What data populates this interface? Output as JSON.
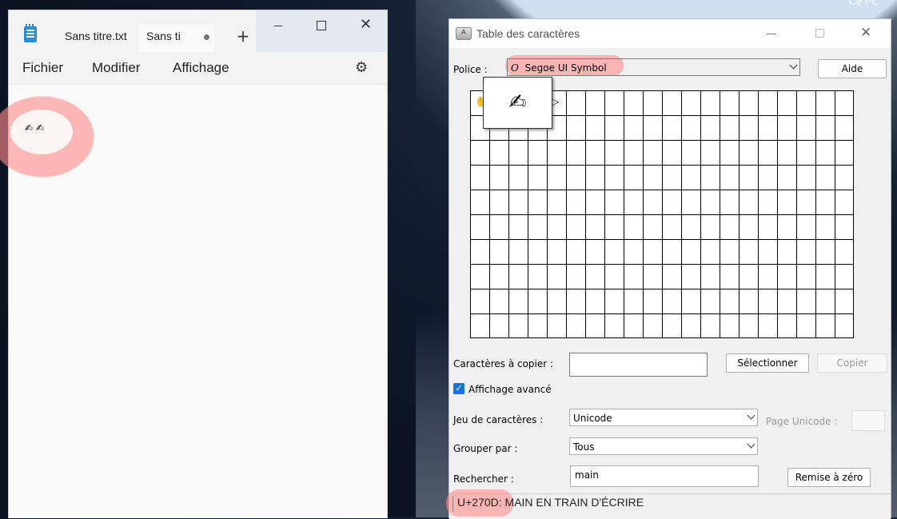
{
  "desktop": {
    "label": "Ce PC"
  },
  "notepad": {
    "tabs": [
      {
        "label": "Sans titre.txt"
      },
      {
        "label": "Sans ti"
      }
    ],
    "new_tab_label": "+",
    "menu": [
      "Fichier",
      "Modifier",
      "Affichage"
    ],
    "content_text": "✍ ✍",
    "icons": {
      "app": "notepad-icon",
      "unsaved": "unsaved-dot-icon",
      "settings": "gear-icon",
      "minimize": "minimize-icon",
      "maximize": "maximize-icon",
      "close": "close-icon"
    },
    "window_close_glyph": "✕",
    "settings_glyph": "⚙"
  },
  "charmap": {
    "title": "Table des caractères",
    "icon_text": "A",
    "font_label": "Police :",
    "font_value": "Segoe UI Symbol",
    "font_type_glyph": "O",
    "help_button": "Aide",
    "grid_glyphs": {
      "first": "✋",
      "popup": "✍",
      "third": "✎",
      "fourth": "✐",
      "fifth": "▷"
    },
    "copy_label": "Caractères à copier :",
    "select_button": "Sélectionner",
    "copy_button": "Copier",
    "advanced_view_label": "Affichage avancé",
    "advanced_view_checked": true,
    "charset_label": "Jeu de caractères :",
    "charset_value": "Unicode",
    "unicode_page_label": "Page Unicode :",
    "group_by_label": "Grouper par :",
    "group_by_value": "Tous",
    "search_label": "Rechercher :",
    "search_value": "main",
    "reset_button": "Remise à zéro",
    "status": "U+270D: MAIN EN TRAIN D'ÉCRIRE",
    "close_glyph": "✕",
    "checkbox_glyph": "✓"
  },
  "colors": {
    "annotation_highlight": "#ff8c8c",
    "checkbox_accent": "#1a73d9",
    "notepad_icon": "#2a8fd0"
  }
}
